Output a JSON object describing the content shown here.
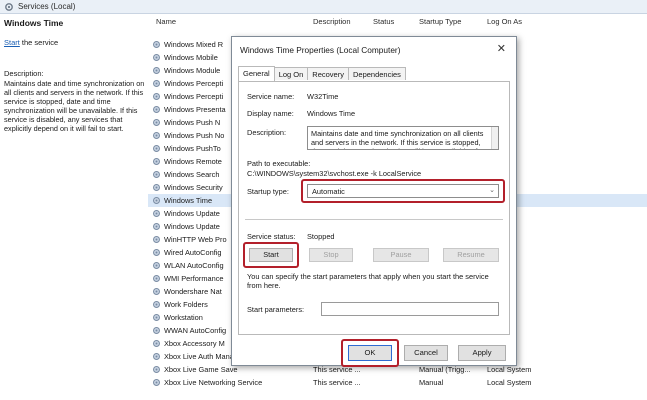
{
  "header": {
    "title": "Services (Local)"
  },
  "left_pane": {
    "service_name": "Windows Time",
    "start_link": "Start",
    "start_suffix": " the service",
    "description_label": "Description:",
    "description": "Maintains date and time synchronization on all clients and servers in the network. If this service is stopped, date and time synchronization will be unavailable. If this service is disabled, any services that explicitly depend on it will fail to start."
  },
  "columns": {
    "name": "Name",
    "description": "Description",
    "status": "Status",
    "startup_type": "Startup Type",
    "log_on_as": "Log On As"
  },
  "rows": [
    {
      "name": "Windows Mixed R",
      "description": "",
      "startup": "",
      "logon": "stem"
    },
    {
      "name": "Windows Mobile",
      "description": "",
      "startup": "",
      "logon": "stem"
    },
    {
      "name": "Windows Module",
      "description": "",
      "startup": "",
      "logon": "stem"
    },
    {
      "name": "Windows Percepti",
      "description": "",
      "startup": "",
      "logon": "rvice"
    },
    {
      "name": "Windows Percepti",
      "description": "",
      "startup": "",
      "logon": "stem"
    },
    {
      "name": "Windows Presenta",
      "description": "",
      "startup": "",
      "logon": "rvice"
    },
    {
      "name": "Windows Push N",
      "description": "",
      "startup": "",
      "logon": "stem"
    },
    {
      "name": "Windows Push No",
      "description": "",
      "startup": "",
      "logon": "stem"
    },
    {
      "name": "Windows PushTo",
      "description": "",
      "startup": "",
      "logon": "stem"
    },
    {
      "name": "Windows Remote",
      "description": "",
      "startup": "",
      "logon": "k Se..."
    },
    {
      "name": "Windows Search",
      "description": "",
      "startup": "",
      "logon": "stem"
    },
    {
      "name": "Windows Security",
      "description": "",
      "startup": "",
      "logon": "stem"
    },
    {
      "name": "Windows Time",
      "description": "",
      "startup": "",
      "logon": "rvice",
      "selected": true
    },
    {
      "name": "Windows Update",
      "description": "",
      "startup": "",
      "logon": "stem"
    },
    {
      "name": "Windows Update",
      "description": "",
      "startup": "",
      "logon": "stem"
    },
    {
      "name": "WinHTTP Web Pro",
      "description": "",
      "startup": "",
      "logon": "rvice"
    },
    {
      "name": "Wired AutoConfig",
      "description": "",
      "startup": "",
      "logon": "stem"
    },
    {
      "name": "WLAN AutoConfig",
      "description": "",
      "startup": "",
      "logon": "stem"
    },
    {
      "name": "WMI Performance",
      "description": "",
      "startup": "",
      "logon": "stem"
    },
    {
      "name": "Wondershare Nat",
      "description": "",
      "startup": "",
      "logon": "stem"
    },
    {
      "name": "Work Folders",
      "description": "",
      "startup": "",
      "logon": "rvice"
    },
    {
      "name": "Workstation",
      "description": "",
      "startup": "",
      "logon": "k Se..."
    },
    {
      "name": "WWAN AutoConfig",
      "description": "",
      "startup": "",
      "logon": "stem"
    },
    {
      "name": "Xbox Accessory M",
      "description": "",
      "startup": "",
      "logon": "stem"
    },
    {
      "name": "Xbox Live Auth Manager",
      "description": "",
      "startup": "",
      "logon": "stem"
    },
    {
      "name": "Xbox Live Game Save",
      "description": "This service ...",
      "startup": "Manual (Trigg...",
      "logon": "Local System"
    },
    {
      "name": "Xbox Live Networking Service",
      "description": "This service ...",
      "startup": "Manual",
      "logon": "Local System"
    }
  ],
  "dialog": {
    "title": "Windows Time Properties (Local Computer)",
    "close_glyph": "✕",
    "tabs": [
      "General",
      "Log On",
      "Recovery",
      "Dependencies"
    ],
    "service_name_label": "Service name:",
    "service_name": "W32Time",
    "display_name_label": "Display name:",
    "display_name": "Windows Time",
    "description_label": "Description:",
    "description": "Maintains date and time synchronization on all clients and servers in the network. If this service is stopped, date and time synchronization will be unavailable. If",
    "path_label": "Path to executable:",
    "path": "C:\\WINDOWS\\system32\\svchost.exe -k LocalService",
    "startup_type_label": "Startup type:",
    "startup_type": "Automatic",
    "service_status_label": "Service status:",
    "service_status": "Stopped",
    "start_button": "Start",
    "stop_button": "Stop",
    "pause_button": "Pause",
    "resume_button": "Resume",
    "params_hint": "You can specify the start parameters that apply when you start the service from here.",
    "start_params_label": "Start parameters:",
    "start_params_value": "",
    "ok_button": "OK",
    "cancel_button": "Cancel",
    "apply_button": "Apply"
  },
  "colors": {
    "highlight": "#b3202b",
    "selected_row": "#d9e7f7",
    "link": "#1a5fb4"
  }
}
